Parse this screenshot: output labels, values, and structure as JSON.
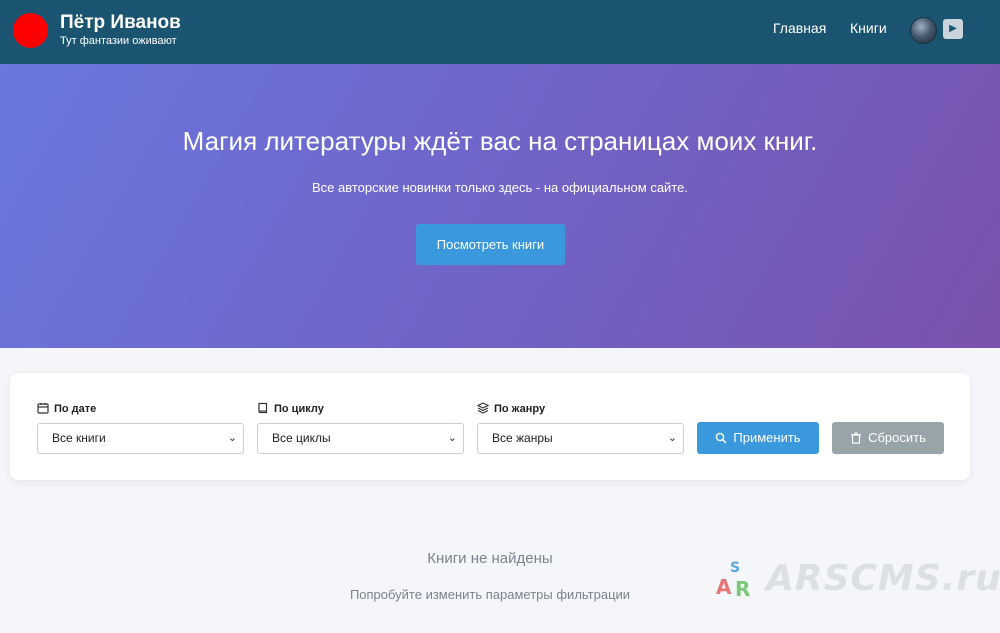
{
  "header": {
    "brand_title": "Пётр Иванов",
    "brand_subtitle": "Тут фантазии оживают",
    "nav": [
      {
        "label": "Главная"
      },
      {
        "label": "Книги"
      }
    ],
    "play_icon": "play-icon",
    "logo_color": "#ff0000",
    "bg_color": "#1b5470"
  },
  "hero": {
    "title": "Магия литературы ждёт вас на страницах моих книг.",
    "subtitle": "Все авторские новинки только здесь - на официальном сайте.",
    "button_label": "Посмотреть книги"
  },
  "filters": {
    "date": {
      "label": "По дате",
      "icon": "calendar-icon",
      "selected": "Все книги"
    },
    "cycle": {
      "label": "По циклу",
      "icon": "book-icon",
      "selected": "Все циклы"
    },
    "genre": {
      "label": "По жанру",
      "icon": "layers-icon",
      "selected": "Все жанры"
    },
    "apply_label": "Применить",
    "reset_label": "Сбросить",
    "accent_color": "#3a98dc",
    "reset_color": "#97a4a8"
  },
  "empty_state": {
    "title": "Книги не найдены",
    "subtitle": "Попробуйте изменить параметры фильтрации"
  },
  "watermark": {
    "text": "ARSCMS.ru",
    "letters": [
      "A",
      "R",
      "S"
    ]
  }
}
